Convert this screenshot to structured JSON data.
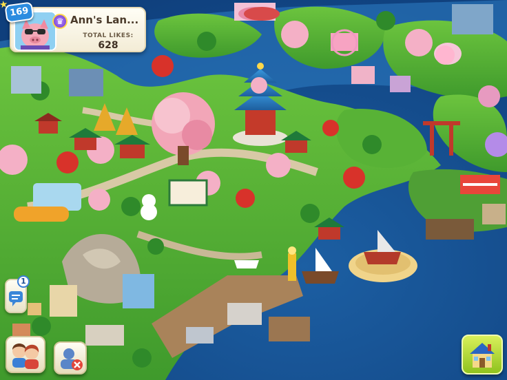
{
  "profile": {
    "level": "169",
    "town_name": "Ann's Lan...",
    "likes_label": "TOTAL LIKES:",
    "likes_value": "628"
  },
  "chat": {
    "unread_count": "1"
  },
  "icons": {
    "avatar": "pig-avatar-icon",
    "rank": "rank-shield-icon",
    "chat": "chat-bubble-icon",
    "friends": "friends-icon",
    "visitor": "remove-user-icon",
    "home": "home-icon"
  },
  "colors": {
    "water": "#1f63a6",
    "grass": "#5fb83a",
    "level_badge": "#2b8ce0",
    "home_button": "#9ccd2a"
  }
}
